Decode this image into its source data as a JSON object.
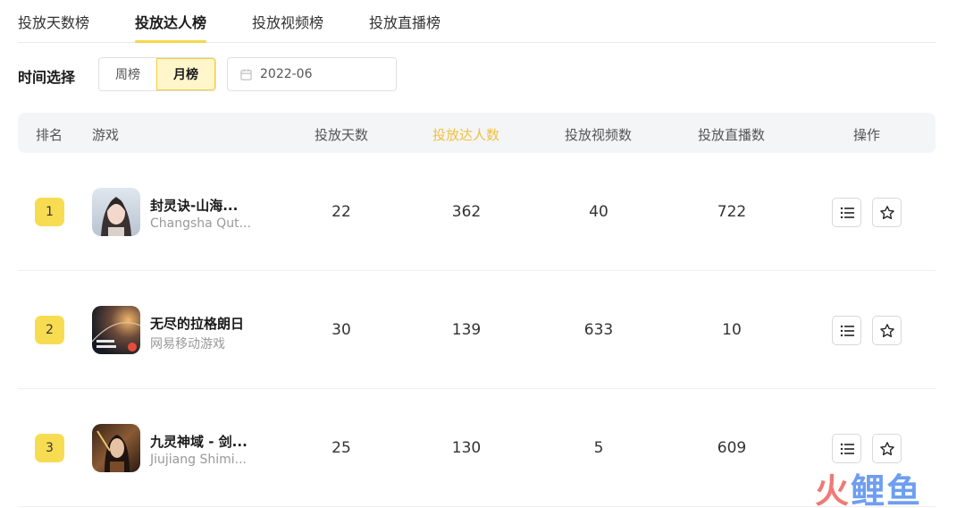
{
  "tabs": [
    {
      "label": "投放天数榜",
      "active": false
    },
    {
      "label": "投放达人榜",
      "active": true
    },
    {
      "label": "投放视频榜",
      "active": false
    },
    {
      "label": "投放直播榜",
      "active": false
    }
  ],
  "filter": {
    "label": "时间选择",
    "options": [
      "周榜",
      "月榜"
    ],
    "selected": "月榜",
    "date_value": "2022-06"
  },
  "table": {
    "headers": {
      "rank": "排名",
      "game": "游戏",
      "days": "投放天数",
      "creators": "投放达人数",
      "videos": "投放视频数",
      "live": "投放直播数",
      "actions": "操作"
    },
    "highlight_column": "creators",
    "highlight_color": "#f0c040",
    "rows": [
      {
        "rank": "1",
        "name": "封灵诀-山海...",
        "developer": "Changsha Qut...",
        "days": "22",
        "creators": "362",
        "videos": "40",
        "live": "722"
      },
      {
        "rank": "2",
        "name": "无尽的拉格朗日",
        "developer": "网易移动游戏",
        "days": "30",
        "creators": "139",
        "videos": "633",
        "live": "10"
      },
      {
        "rank": "3",
        "name": "九灵神域 - 剑...",
        "developer": "Jiujiang Shimi...",
        "days": "25",
        "creators": "130",
        "videos": "5",
        "live": "609"
      }
    ]
  },
  "icons": {
    "calendar": "calendar-icon",
    "list": "list-icon",
    "star": "star-icon"
  },
  "watermark": {
    "part1": "火",
    "part2": "鲤鱼"
  },
  "colors": {
    "accent": "#f7dc52",
    "accent_light": "#fff6cc"
  }
}
